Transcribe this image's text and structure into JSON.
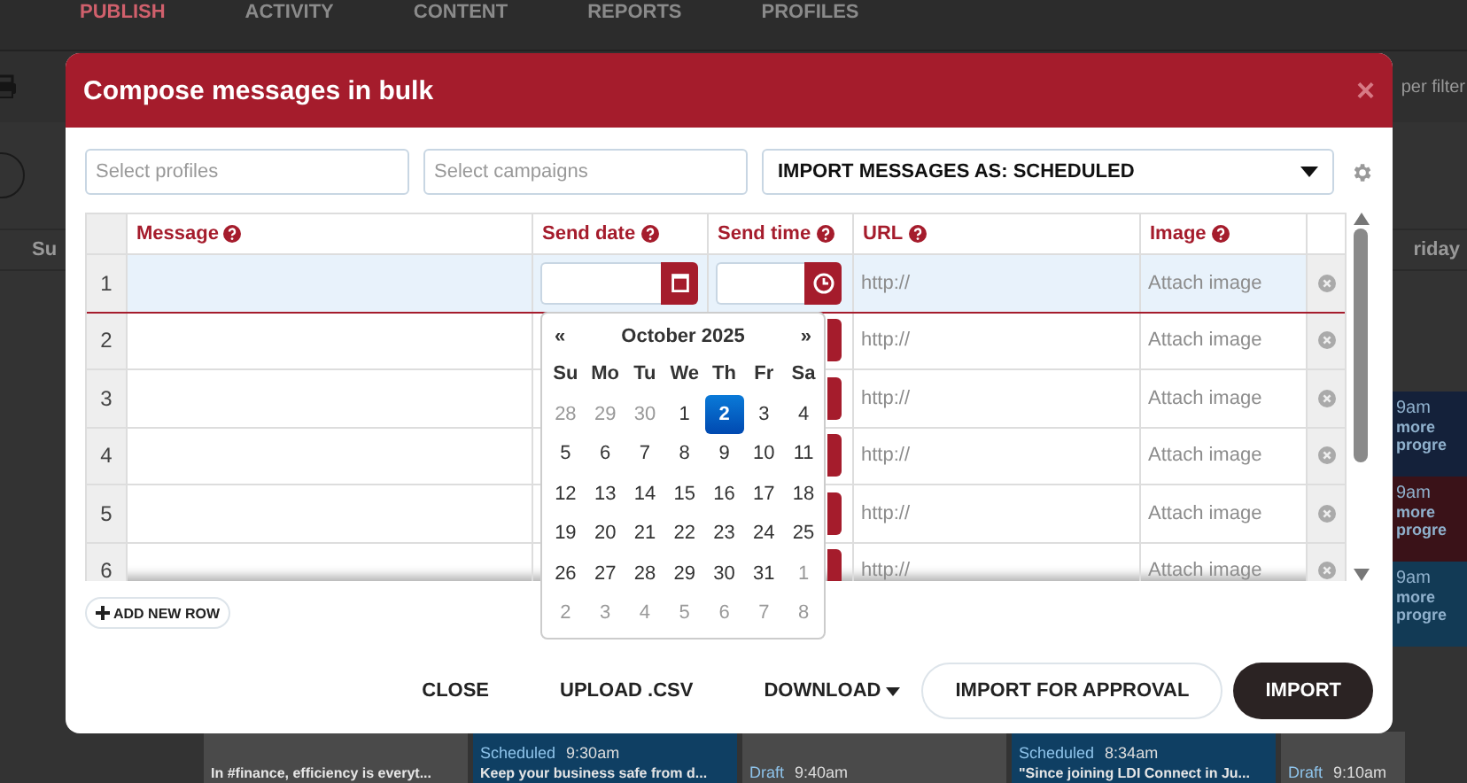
{
  "background": {
    "nav": [
      {
        "label": "PUBLISH",
        "selected": true
      },
      {
        "label": "ACTIVITY",
        "selected": false
      },
      {
        "label": "CONTENT",
        "selected": false
      },
      {
        "label": "REPORTS",
        "selected": false
      },
      {
        "label": "PROFILES",
        "selected": false
      }
    ],
    "filter_placeholder": "per filter",
    "day_headers": [
      "Su",
      "riday"
    ],
    "side_cards": [
      {
        "time": "9am",
        "text": "more progre",
        "color": "#14213a"
      },
      {
        "time": "9am",
        "text": "more progre",
        "color": "#3a1218"
      },
      {
        "time": "9am",
        "text": "more progre",
        "color": "#123a55"
      }
    ],
    "bottom_cards": [
      {
        "text": "In #finance, efficiency is everyt...",
        "color": "#4a4a4a"
      },
      {
        "status": "Scheduled",
        "time": "9:30am",
        "text": "Keep your business safe from d...",
        "color": "#0f3f63"
      },
      {
        "status": "Draft",
        "time": "9:40am",
        "color": "#4a4a4a"
      },
      {
        "status": "Scheduled",
        "time": "8:34am",
        "text": "\"Since joining LDI Connect in Ju...",
        "color": "#0f3f63"
      },
      {
        "status": "Draft",
        "time": "9:10am",
        "color": "#4a4a4a"
      }
    ]
  },
  "modal": {
    "title": "Compose messages in bulk",
    "close": "×",
    "profiles": {
      "placeholder": "Select profiles"
    },
    "campaigns": {
      "placeholder": "Select campaigns"
    },
    "import_as": "IMPORT MESSAGES AS: SCHEDULED",
    "columns": [
      "Message",
      "Send date",
      "Send time",
      "URL",
      "Image"
    ],
    "rows": [
      {
        "number": "1",
        "url": "http://",
        "image": "Attach image",
        "selected": true
      },
      {
        "number": "2",
        "url": "http://",
        "image": "Attach image",
        "selected": false
      },
      {
        "number": "3",
        "url": "http://",
        "image": "Attach image",
        "selected": false
      },
      {
        "number": "4",
        "url": "http://",
        "image": "Attach image",
        "selected": false
      },
      {
        "number": "5",
        "url": "http://",
        "image": "Attach image",
        "selected": false
      },
      {
        "number": "6",
        "url": "http://",
        "image": "Attach image",
        "selected": false
      }
    ],
    "datepicker": {
      "prev": "«",
      "month": "October 2025",
      "next": "»",
      "weekdays": [
        "Su",
        "Mo",
        "Tu",
        "We",
        "Th",
        "Fr",
        "Sa"
      ],
      "weeks": [
        [
          {
            "day": "28",
            "other_month": true,
            "selected": false
          },
          {
            "day": "29",
            "other_month": true,
            "selected": false
          },
          {
            "day": "30",
            "other_month": true,
            "selected": false
          },
          {
            "day": "1",
            "other_month": false,
            "selected": false
          },
          {
            "day": "2",
            "other_month": false,
            "selected": true
          },
          {
            "day": "3",
            "other_month": false,
            "selected": false
          },
          {
            "day": "4",
            "other_month": false,
            "selected": false
          }
        ],
        [
          {
            "day": "5",
            "other_month": false,
            "selected": false
          },
          {
            "day": "6",
            "other_month": false,
            "selected": false
          },
          {
            "day": "7",
            "other_month": false,
            "selected": false
          },
          {
            "day": "8",
            "other_month": false,
            "selected": false
          },
          {
            "day": "9",
            "other_month": false,
            "selected": false
          },
          {
            "day": "10",
            "other_month": false,
            "selected": false
          },
          {
            "day": "11",
            "other_month": false,
            "selected": false
          }
        ],
        [
          {
            "day": "12",
            "other_month": false,
            "selected": false
          },
          {
            "day": "13",
            "other_month": false,
            "selected": false
          },
          {
            "day": "14",
            "other_month": false,
            "selected": false
          },
          {
            "day": "15",
            "other_month": false,
            "selected": false
          },
          {
            "day": "16",
            "other_month": false,
            "selected": false
          },
          {
            "day": "17",
            "other_month": false,
            "selected": false
          },
          {
            "day": "18",
            "other_month": false,
            "selected": false
          }
        ],
        [
          {
            "day": "19",
            "other_month": false,
            "selected": false
          },
          {
            "day": "20",
            "other_month": false,
            "selected": false
          },
          {
            "day": "21",
            "other_month": false,
            "selected": false
          },
          {
            "day": "22",
            "other_month": false,
            "selected": false
          },
          {
            "day": "23",
            "other_month": false,
            "selected": false
          },
          {
            "day": "24",
            "other_month": false,
            "selected": false
          },
          {
            "day": "25",
            "other_month": false,
            "selected": false
          }
        ],
        [
          {
            "day": "26",
            "other_month": false,
            "selected": false
          },
          {
            "day": "27",
            "other_month": false,
            "selected": false
          },
          {
            "day": "28",
            "other_month": false,
            "selected": false
          },
          {
            "day": "29",
            "other_month": false,
            "selected": false
          },
          {
            "day": "30",
            "other_month": false,
            "selected": false
          },
          {
            "day": "31",
            "other_month": false,
            "selected": false
          },
          {
            "day": "1",
            "other_month": true,
            "selected": false
          }
        ],
        [
          {
            "day": "2",
            "other_month": true,
            "selected": false
          },
          {
            "day": "3",
            "other_month": true,
            "selected": false
          },
          {
            "day": "4",
            "other_month": true,
            "selected": false
          },
          {
            "day": "5",
            "other_month": true,
            "selected": false
          },
          {
            "day": "6",
            "other_month": true,
            "selected": false
          },
          {
            "day": "7",
            "other_month": true,
            "selected": false
          },
          {
            "day": "8",
            "other_month": true,
            "selected": false
          }
        ]
      ]
    },
    "add_row": "ADD NEW ROW",
    "footer": {
      "close": "CLOSE",
      "upload": "UPLOAD .CSV",
      "download": "DOWNLOAD",
      "approval": "IMPORT FOR APPROVAL",
      "import": "IMPORT"
    }
  }
}
